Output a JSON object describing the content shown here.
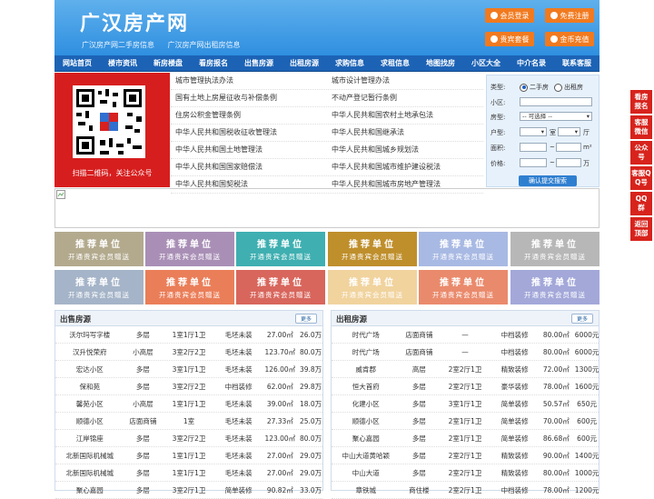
{
  "header": {
    "logo": "广汉房产网",
    "sub_links": [
      "广汉房产网二手房信息",
      "广汉房产网出租房信息"
    ],
    "buttons": [
      "会员登录",
      "免费注册",
      "贵宾套餐",
      "金币充值"
    ]
  },
  "nav": [
    "网站首页",
    "楼市资讯",
    "新房楼盘",
    "看房报名",
    "出售房源",
    "出租房源",
    "求购信息",
    "求租信息",
    "地图找房",
    "小区大全",
    "中介名录",
    "联系客服"
  ],
  "qr": {
    "caption": "扫描二维码，关注公众号"
  },
  "links": [
    [
      "城市管理执法办法",
      "城市设计管理办法"
    ],
    [
      "国有土地上房屋征收与补偿条例",
      "不动产登记暂行条例"
    ],
    [
      "住房公积金管理条例",
      "中华人民共和国农村土地承包法"
    ],
    [
      "中华人民共和国税收征收管理法",
      "中华人民共和国继承法"
    ],
    [
      "中华人民共和国土地管理法",
      "中华人民共和国城乡规划法"
    ],
    [
      "中华人民共和国国家赔偿法",
      "中华人民共和国城市维护建设税法"
    ],
    [
      "中华人民共和国契税法",
      "中华人民共和国城市房地产管理法"
    ]
  ],
  "search": {
    "type_label": "类型:",
    "type_options": [
      "二手房",
      "出租房"
    ],
    "community_label": "小区:",
    "house_type_label": "房型:",
    "house_type_value": "-- 可选择 --",
    "layout_label": "户型:",
    "room_unit": "室",
    "hall_unit": "厅",
    "area_label": "面积:",
    "area_unit": "m²",
    "price_label": "价格:",
    "price_unit": "万",
    "tilde": "~",
    "submit": "确认提交搜索"
  },
  "tile_text": {
    "title": "推荐单位",
    "sub": "开通贵宾会员赠送"
  },
  "tile_colors": [
    "#b3aa8e",
    "#a98fb6",
    "#3fafb1",
    "#bf8f2c",
    "#a8b9e3",
    "#b8b7b7",
    "#a5b4c8",
    "#ea7e59",
    "#d8665c",
    "#f1d39e",
    "#ea8a6c",
    "#a3a8d9"
  ],
  "sale": {
    "title": "出售房源",
    "more": "更多",
    "rows": [
      [
        "沃尔玛写字楼",
        "多层",
        "1室1厅1卫",
        "毛坯未装",
        "27.00㎡",
        "26.0万"
      ],
      [
        "汉升悦荣府",
        "小高层",
        "3室2厅2卫",
        "毛坯未装",
        "123.70㎡",
        "80.0万"
      ],
      [
        "宏达小区",
        "多层",
        "3室1厅1卫",
        "毛坯未装",
        "126.00㎡",
        "39.8万"
      ],
      [
        "保和苑",
        "多层",
        "3室2厅2卫",
        "中档装修",
        "62.00㎡",
        "29.8万"
      ],
      [
        "馨苑小区",
        "小高层",
        "1室1厅1卫",
        "毛坯未装",
        "39.00㎡",
        "18.0万"
      ],
      [
        "顺德小区",
        "店面商铺",
        "1室",
        "毛坯未装",
        "27.33㎡",
        "25.0万"
      ],
      [
        "江岸锦座",
        "多层",
        "3室2厅2卫",
        "毛坯未装",
        "123.00㎡",
        "80.0万"
      ],
      [
        "北新国际机械城",
        "多层",
        "1室1厅1卫",
        "毛坯未装",
        "27.00㎡",
        "29.0万"
      ],
      [
        "北新国际机械城",
        "多层",
        "1室1厅1卫",
        "毛坯未装",
        "27.00㎡",
        "29.0万"
      ],
      [
        "聚心嘉园",
        "多层",
        "3室2厅1卫",
        "简单装修",
        "90.82㎡",
        "33.0万"
      ]
    ]
  },
  "rent": {
    "title": "出租房源",
    "more": "更多",
    "rows": [
      [
        "时代广场",
        "店面商铺",
        "—",
        "中档装修",
        "80.00㎡",
        "6000元"
      ],
      [
        "时代广场",
        "店面商铺",
        "—",
        "中档装修",
        "80.00㎡",
        "6000元"
      ],
      [
        "威肯郡",
        "高层",
        "2室2厅1卫",
        "精致装修",
        "72.00㎡",
        "1300元"
      ],
      [
        "恒大首府",
        "多层",
        "2室2厅1卫",
        "豪华装修",
        "78.00㎡",
        "1600元"
      ],
      [
        "化建小区",
        "多层",
        "3室1厅1卫",
        "简单装修",
        "50.57㎡",
        "650元"
      ],
      [
        "顺德小区",
        "多层",
        "2室1厅1卫",
        "简单装修",
        "70.00㎡",
        "600元"
      ],
      [
        "聚心嘉园",
        "多层",
        "2室1厅1卫",
        "简单装修",
        "86.68㎡",
        "600元"
      ],
      [
        "中山大道黄哈颖",
        "多层",
        "2室2厅1卫",
        "精致装修",
        "90.00㎡",
        "1400元"
      ],
      [
        "中山大道",
        "多层",
        "2室2厅1卫",
        "精致装修",
        "80.00㎡",
        "1000元"
      ],
      [
        "章铁城",
        "商住楼",
        "2室2厅1卫",
        "中档装修",
        "78.00㎡",
        "1200元"
      ]
    ]
  },
  "side_tabs": [
    "看房报名",
    "客服微信",
    "公众号",
    "客服QQ号",
    "QQ群",
    "返回顶部"
  ]
}
